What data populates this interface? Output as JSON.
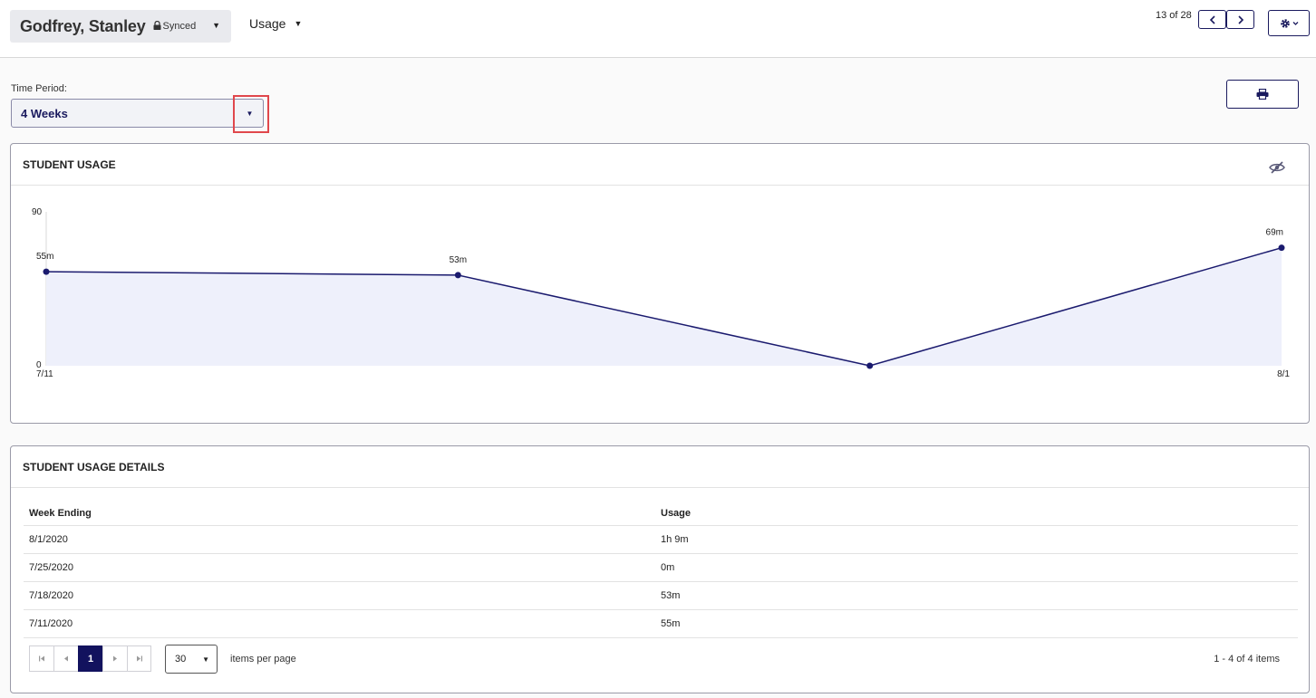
{
  "header": {
    "student_name": "Godfrey, Stanley",
    "sync_status": "Synced",
    "menu_label": "Usage",
    "record_position": "13 of 28"
  },
  "filters": {
    "time_period_label": "Time Period:",
    "time_period_value": "4 Weeks"
  },
  "usage_card": {
    "title": "STUDENT USAGE"
  },
  "chart_data": {
    "type": "area",
    "title": "STUDENT USAGE",
    "xlabel": "",
    "ylabel": "",
    "ylim": [
      0,
      90
    ],
    "y_tick_labels": [
      "90",
      "0"
    ],
    "x_tick_labels": [
      "7/11",
      "8/1"
    ],
    "x": [
      "7/11",
      "7/18",
      "7/25",
      "8/1"
    ],
    "series": [
      {
        "values": [
          55,
          53,
          0,
          69
        ],
        "data_labels": [
          "55m",
          "53m",
          "",
          "69m"
        ]
      }
    ],
    "grid": false,
    "legend": "none",
    "colors": {
      "line": "#1a1a6e",
      "fill": "#eef0fb"
    }
  },
  "details_card": {
    "title": "STUDENT USAGE DETAILS",
    "columns": [
      "Week Ending",
      "Usage"
    ],
    "rows": [
      [
        "8/1/2020",
        "1h 9m"
      ],
      [
        "7/25/2020",
        "0m"
      ],
      [
        "7/18/2020",
        "53m"
      ],
      [
        "7/11/2020",
        "55m"
      ]
    ],
    "pagination": {
      "current_page": "1",
      "page_size": "30",
      "page_size_label": "items per page",
      "summary": "1 - 4 of 4 items"
    }
  },
  "icons": {
    "lock": "lock-icon",
    "prev": "chevron-left-icon",
    "next": "chevron-right-icon",
    "settings": "gear-icon",
    "print": "printer-icon",
    "hide": "eye-slash-icon"
  },
  "colors": {
    "accent": "#1a1a5e",
    "highlight": "#e0474c"
  }
}
